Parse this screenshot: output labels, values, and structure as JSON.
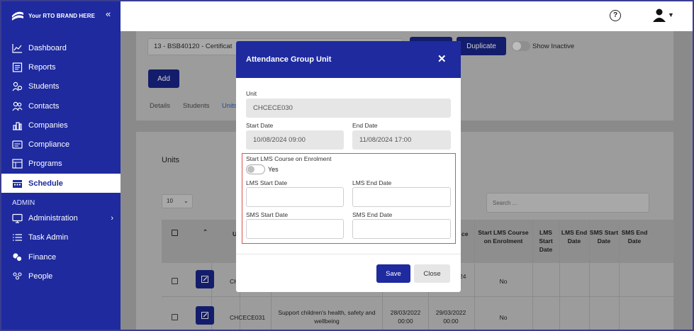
{
  "brand": {
    "name": "Your RTO BRAND HERE"
  },
  "sidebar": {
    "items": [
      {
        "label": "Dashboard",
        "icon": "chart-line-icon"
      },
      {
        "label": "Reports",
        "icon": "report-icon"
      },
      {
        "label": "Students",
        "icon": "students-icon"
      },
      {
        "label": "Contacts",
        "icon": "contacts-icon"
      },
      {
        "label": "Companies",
        "icon": "companies-icon"
      },
      {
        "label": "Compliance",
        "icon": "compliance-icon"
      },
      {
        "label": "Programs",
        "icon": "programs-icon"
      },
      {
        "label": "Schedule",
        "icon": "calendar-icon",
        "active": true
      }
    ],
    "admin_section": "ADMIN",
    "admin_items": [
      {
        "label": "Administration",
        "icon": "monitor-icon"
      },
      {
        "label": "Task Admin",
        "icon": "list-icon"
      },
      {
        "label": "Finance",
        "icon": "coins-icon"
      },
      {
        "label": "People",
        "icon": "people-icon"
      }
    ]
  },
  "background": {
    "program_select": "13 - BSB40120 - Certificat",
    "duplicate_label": "Duplicate",
    "show_inactive_label": "Show Inactive",
    "add_label": "Add",
    "tabs": [
      "Details",
      "Students",
      "Units"
    ],
    "units_title": "Units",
    "page_size": "10",
    "search_placeholder": "Search ...",
    "columns": {
      "col_u": "U",
      "col_ce": "ce",
      "start_lms": "Start LMS Course on Enrolment",
      "lms_start": "LMS Start Date",
      "lms_end": "LMS End Date",
      "sms_start": "SMS Start Date",
      "sms_end": "SMS End Date"
    },
    "rows": [
      {
        "code": "CH",
        "date_tail": "24",
        "start_lms": "No"
      },
      {
        "code": "CHCECE031",
        "name": "Support children's health, safety and wellbeing",
        "start": "28/03/2022 00:00",
        "end": "29/03/2022 00:00",
        "start_lms": "No"
      }
    ]
  },
  "modal": {
    "title": "Attendance Group Unit",
    "close_glyph": "✕",
    "unit_label": "Unit",
    "unit_value": "CHCECE030",
    "start_label": "Start Date",
    "start_value": "10/08/2024 09:00",
    "end_label": "End Date",
    "end_value": "11/08/2024 17:00",
    "lms_enrol_label": "Start LMS Course on Enrolment",
    "lms_toggle_text": "Yes",
    "lms_start_label": "LMS Start Date",
    "lms_end_label": "LMS End Date",
    "sms_start_label": "SMS Start Date",
    "sms_end_label": "SMS End Date",
    "save_label": "Save",
    "close_label": "Close"
  },
  "colors": {
    "primary": "#1e2a9e",
    "highlight_border": "#d9534f"
  }
}
